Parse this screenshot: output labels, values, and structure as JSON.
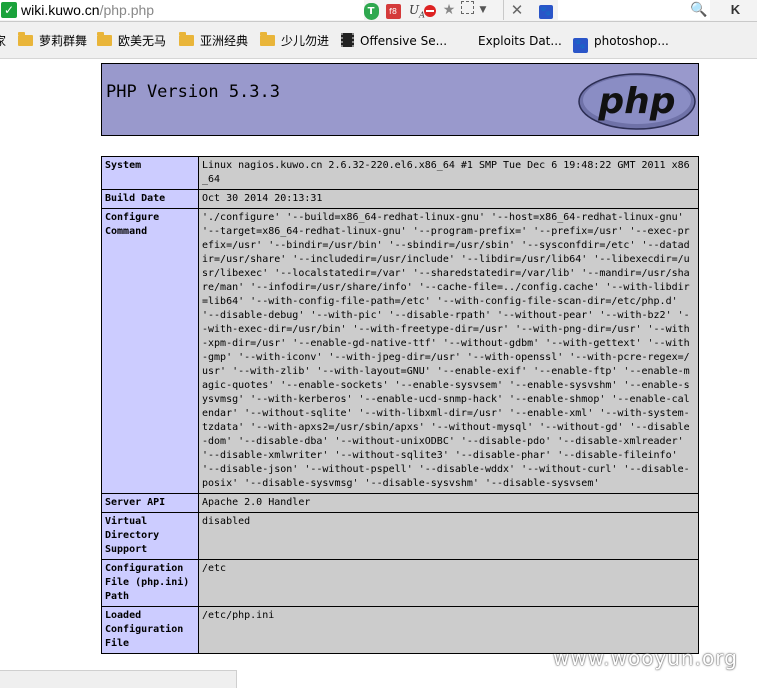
{
  "browser": {
    "url_host": "wiki.kuwo.cn",
    "url_path": "/php.php",
    "search_button_label": "K",
    "bookmarks": [
      {
        "label": "家",
        "icon": "folder-icon"
      },
      {
        "label": "萝莉群舞",
        "icon": "folder-icon"
      },
      {
        "label": "欧美无马",
        "icon": "folder-icon"
      },
      {
        "label": "亚洲经典",
        "icon": "folder-icon"
      },
      {
        "label": "少儿勿进",
        "icon": "folder-icon"
      },
      {
        "label": "Offensive Se...",
        "icon": "film-icon"
      },
      {
        "label": "Exploits Dat...",
        "icon": "page-icon"
      },
      {
        "label": "photoshop...",
        "icon": "paw-icon"
      }
    ]
  },
  "phpinfo": {
    "version_title": "PHP Version 5.3.3",
    "logo_text": "php",
    "rows": [
      {
        "key": "System",
        "value": "Linux nagios.kuwo.cn 2.6.32-220.el6.x86_64 #1 SMP Tue Dec 6 19:48:22 GMT 2011 x86_64"
      },
      {
        "key": "Build Date",
        "value": "Oct 30 2014 20:13:31"
      },
      {
        "key": "Configure Command",
        "value": "'./configure' '--build=x86_64-redhat-linux-gnu' '--host=x86_64-redhat-linux-gnu' '--target=x86_64-redhat-linux-gnu' '--program-prefix=' '--prefix=/usr' '--exec-prefix=/usr' '--bindir=/usr/bin' '--sbindir=/usr/sbin' '--sysconfdir=/etc' '--datadir=/usr/share' '--includedir=/usr/include' '--libdir=/usr/lib64' '--libexecdir=/usr/libexec' '--localstatedir=/var' '--sharedstatedir=/var/lib' '--mandir=/usr/share/man' '--infodir=/usr/share/info' '--cache-file=../config.cache' '--with-libdir=lib64' '--with-config-file-path=/etc' '--with-config-file-scan-dir=/etc/php.d' '--disable-debug' '--with-pic' '--disable-rpath' '--without-pear' '--with-bz2' '--with-exec-dir=/usr/bin' '--with-freetype-dir=/usr' '--with-png-dir=/usr' '--with-xpm-dir=/usr' '--enable-gd-native-ttf' '--without-gdbm' '--with-gettext' '--with-gmp' '--with-iconv' '--with-jpeg-dir=/usr' '--with-openssl' '--with-pcre-regex=/usr' '--with-zlib' '--with-layout=GNU' '--enable-exif' '--enable-ftp' '--enable-magic-quotes' '--enable-sockets' '--enable-sysvsem' '--enable-sysvshm' '--enable-sysvmsg' '--with-kerberos' '--enable-ucd-snmp-hack' '--enable-shmop' '--enable-calendar' '--without-sqlite' '--with-libxml-dir=/usr' '--enable-xml' '--with-system-tzdata' '--with-apxs2=/usr/sbin/apxs' '--without-mysql' '--without-gd' '--disable-dom' '--disable-dba' '--without-unixODBC' '--disable-pdo' '--disable-xmlreader' '--disable-xmlwriter' '--without-sqlite3' '--disable-phar' '--disable-fileinfo' '--disable-json' '--without-pspell' '--disable-wddx' '--without-curl' '--disable-posix' '--disable-sysvmsg' '--disable-sysvshm' '--disable-sysvsem'"
      },
      {
        "key": "Server API",
        "value": "Apache 2.0 Handler"
      },
      {
        "key": "Virtual Directory Support",
        "value": "disabled"
      },
      {
        "key": "Configuration File (php.ini) Path",
        "value": "/etc"
      },
      {
        "key": "Loaded Configuration File",
        "value": "/etc/php.ini"
      }
    ]
  },
  "watermark": "www.wooyun.org",
  "colors": {
    "header_bg": "#9999cc",
    "key_cell_bg": "#ccccff",
    "value_cell_bg": "#cccccc"
  }
}
